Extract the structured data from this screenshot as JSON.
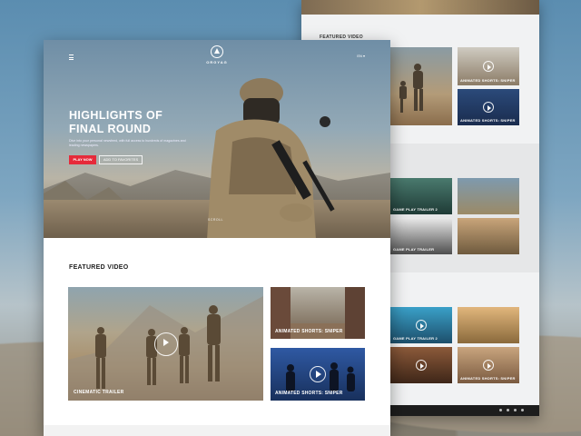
{
  "back_page": {
    "featured_title": "FEATURED VIDEO",
    "featured": [
      {
        "caption": ""
      },
      {
        "caption": "Animated Shorts: Sniper"
      },
      {
        "caption": "Animated Shorts: Sniper"
      }
    ],
    "section2": [
      {
        "caption": "Game Play Trailer 2"
      },
      {
        "caption": ""
      },
      {
        "caption": "Game Play Trailer"
      },
      {
        "caption": ""
      },
      {
        "caption": ""
      }
    ],
    "section3": [
      {
        "caption": "Game Play Trailer 2"
      },
      {
        "caption": "Animated Shorts: Sniper"
      },
      {
        "caption": ""
      },
      {
        "caption": ""
      },
      {
        "caption": ""
      }
    ]
  },
  "header": {
    "logo_text": "ORGYAG",
    "language": "EN ▾"
  },
  "hero": {
    "title": "HIGHLIGHTS OF FINAL ROUND",
    "subtitle": "Dive into your personal newsfeed, with full access to hundreds of magazines and leading newspapers.",
    "play_button": "PLAY NOW",
    "favorites_button": "ADD TO FAVORITES",
    "scroll_label": "SCROLL"
  },
  "featured": {
    "title": "FEATURED VIDEO",
    "main_caption": "CINEMATIC TRAILER",
    "side": [
      {
        "caption": "ANIMATED SHORTS: SNIPER"
      },
      {
        "caption": "ANIMATED SHORTS: SNIPER"
      }
    ]
  },
  "colors": {
    "accent": "#e62a3a",
    "page_bg": "#ffffff"
  }
}
